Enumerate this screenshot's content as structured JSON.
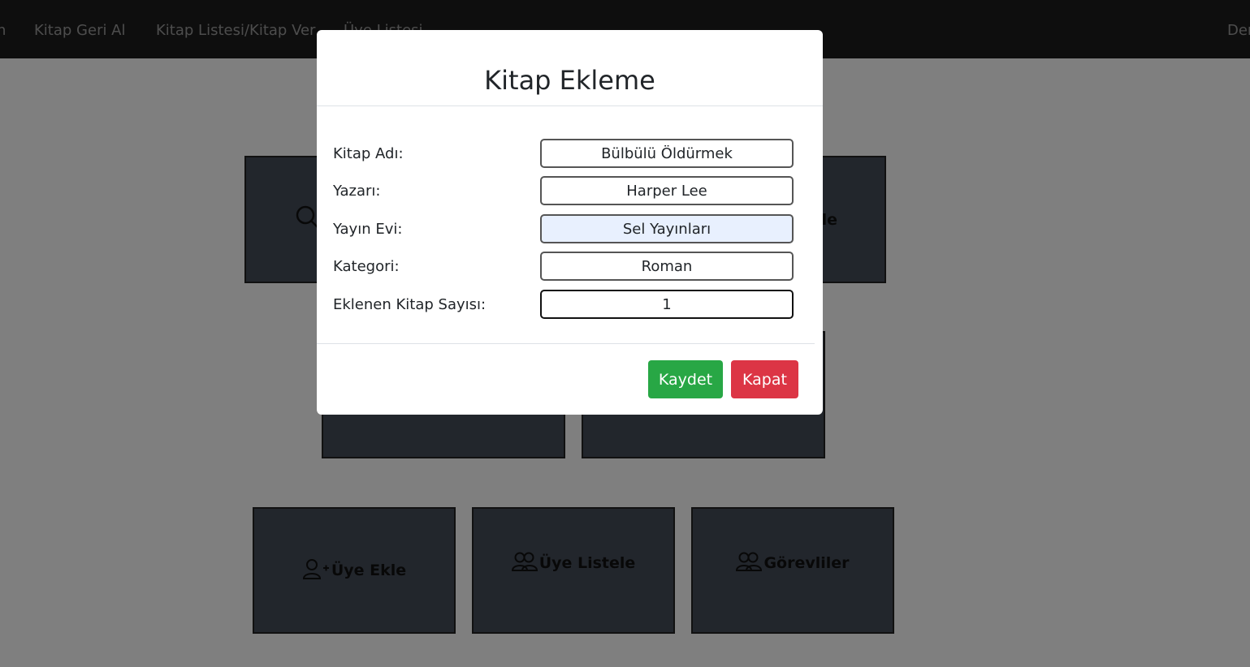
{
  "navbar": {
    "cut_left": "n",
    "items": [
      "Kitap Geri Al",
      "Kitap Listesi/Kitap Ver",
      "Üye Listesi"
    ],
    "right_cut": "Der"
  },
  "tiles": {
    "search_partial": "",
    "kitap_ekle_partial": "le",
    "uye_ekle": "Üye Ekle",
    "uye_listele": "Üye Listele",
    "gorevliler": "Görevliler"
  },
  "modal": {
    "title": "Kitap Ekleme",
    "fields": [
      {
        "label": "Kitap Adı:",
        "value": "Bülbülü Öldürmek"
      },
      {
        "label": "Yazarı:",
        "value": "Harper Lee"
      },
      {
        "label": "Yayın Evi:",
        "value": "Sel Yayınları"
      },
      {
        "label": "Kategori:",
        "value": "Roman"
      },
      {
        "label": "Eklenen Kitap Sayısı:",
        "value": "1"
      }
    ],
    "save_label": "Kaydet",
    "close_label": "Kapat"
  },
  "colors": {
    "navbar": "#1c1c1c",
    "tile": "#454c59",
    "save": "#28a745",
    "close": "#dc3545",
    "autofill": "#e8f0fe"
  },
  "icons": [
    "search-icon",
    "user-plus-icon",
    "users-icon"
  ]
}
